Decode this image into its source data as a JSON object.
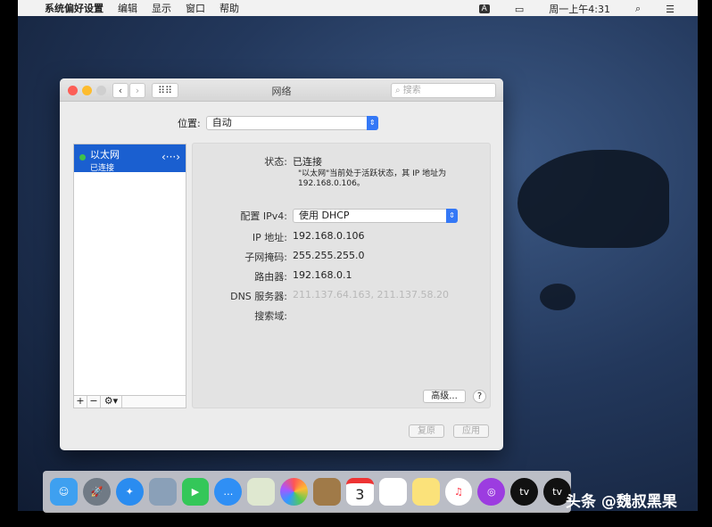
{
  "menubar": {
    "app": "系统偏好设置",
    "items": [
      "编辑",
      "显示",
      "窗口",
      "帮助"
    ],
    "input_badge": "A",
    "clock": "周一上午4:31"
  },
  "window": {
    "title": "网络",
    "search_placeholder": "搜索",
    "location_label": "位置:",
    "location_value": "自动",
    "services": [
      {
        "name": "以太网",
        "status": "已连接",
        "status_color": "#3fc24b"
      }
    ],
    "status_label": "状态:",
    "status_value": "已连接",
    "status_desc": "\"以太网\"当前处于活跃状态，其 IP 地址为 192.168.0.106。",
    "fields": [
      {
        "label": "配置 IPv4:",
        "value": "使用 DHCP"
      },
      {
        "label": "IP 地址:",
        "value": "192.168.0.106"
      },
      {
        "label": "子网掩码:",
        "value": "255.255.255.0"
      },
      {
        "label": "路由器:",
        "value": "192.168.0.1"
      },
      {
        "label": "DNS 服务器:",
        "value": "211.137.64.163, 211.137.58.20"
      },
      {
        "label": "搜索域:",
        "value": ""
      }
    ],
    "advanced": "高级...",
    "help": "?",
    "revert": "复原",
    "apply": "应用",
    "add": "+",
    "remove": "−"
  },
  "dock": {
    "apps": [
      "finder",
      "launchpad",
      "safari",
      "preview",
      "facetime",
      "messages",
      "maps",
      "photos",
      "contacts",
      "calendar",
      "reminders",
      "notes",
      "music",
      "podcasts",
      "tv",
      "tv"
    ],
    "calendar_day": "3",
    "tv_label": "tv"
  },
  "overlay": {
    "credit": "头条 @魏叔黑果"
  },
  "accent": "#1a5fd0"
}
